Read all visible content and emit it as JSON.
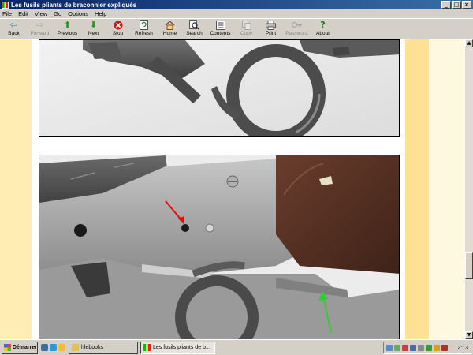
{
  "window": {
    "title": "Les fusils pliants de braconnier expliqués",
    "controls": [
      "_",
      "□",
      "×"
    ]
  },
  "menu": [
    "File",
    "Edit",
    "View",
    "Go",
    "Options",
    "Help"
  ],
  "toolbar": {
    "buttons": [
      {
        "label": "Back",
        "icon": "back-arrow-icon",
        "enabled": true
      },
      {
        "label": "Forward",
        "icon": "forward-arrow-icon",
        "enabled": false
      },
      {
        "label": "Previous",
        "icon": "up-arrow-icon",
        "enabled": true
      },
      {
        "label": "Next",
        "icon": "down-arrow-icon",
        "enabled": true
      },
      {
        "label": "Stop",
        "icon": "stop-icon",
        "enabled": true
      },
      {
        "label": "Refresh",
        "icon": "refresh-icon",
        "enabled": true
      },
      {
        "label": "Home",
        "icon": "home-icon",
        "enabled": true
      },
      {
        "label": "Search",
        "icon": "search-icon",
        "enabled": true
      },
      {
        "label": "Contents",
        "icon": "contents-icon",
        "enabled": true
      },
      {
        "label": "Copy",
        "icon": "copy-icon",
        "enabled": false
      },
      {
        "label": "Print",
        "icon": "print-icon",
        "enabled": true
      },
      {
        "label": "Password",
        "icon": "key-icon",
        "enabled": false
      },
      {
        "label": "About",
        "icon": "about-icon",
        "enabled": true
      }
    ]
  },
  "colors": {
    "left_margin": "#ffedb3",
    "right_margin": "#ffe196",
    "arrow_red": "#e01010",
    "arrow_green": "#33cc33"
  },
  "taskbar": {
    "start_label": "Démarrer",
    "tasks": [
      {
        "label": "hlebooks",
        "active": false
      },
      {
        "label": "Les fusils pliants de b...",
        "active": true
      }
    ],
    "clock": "12:13"
  }
}
